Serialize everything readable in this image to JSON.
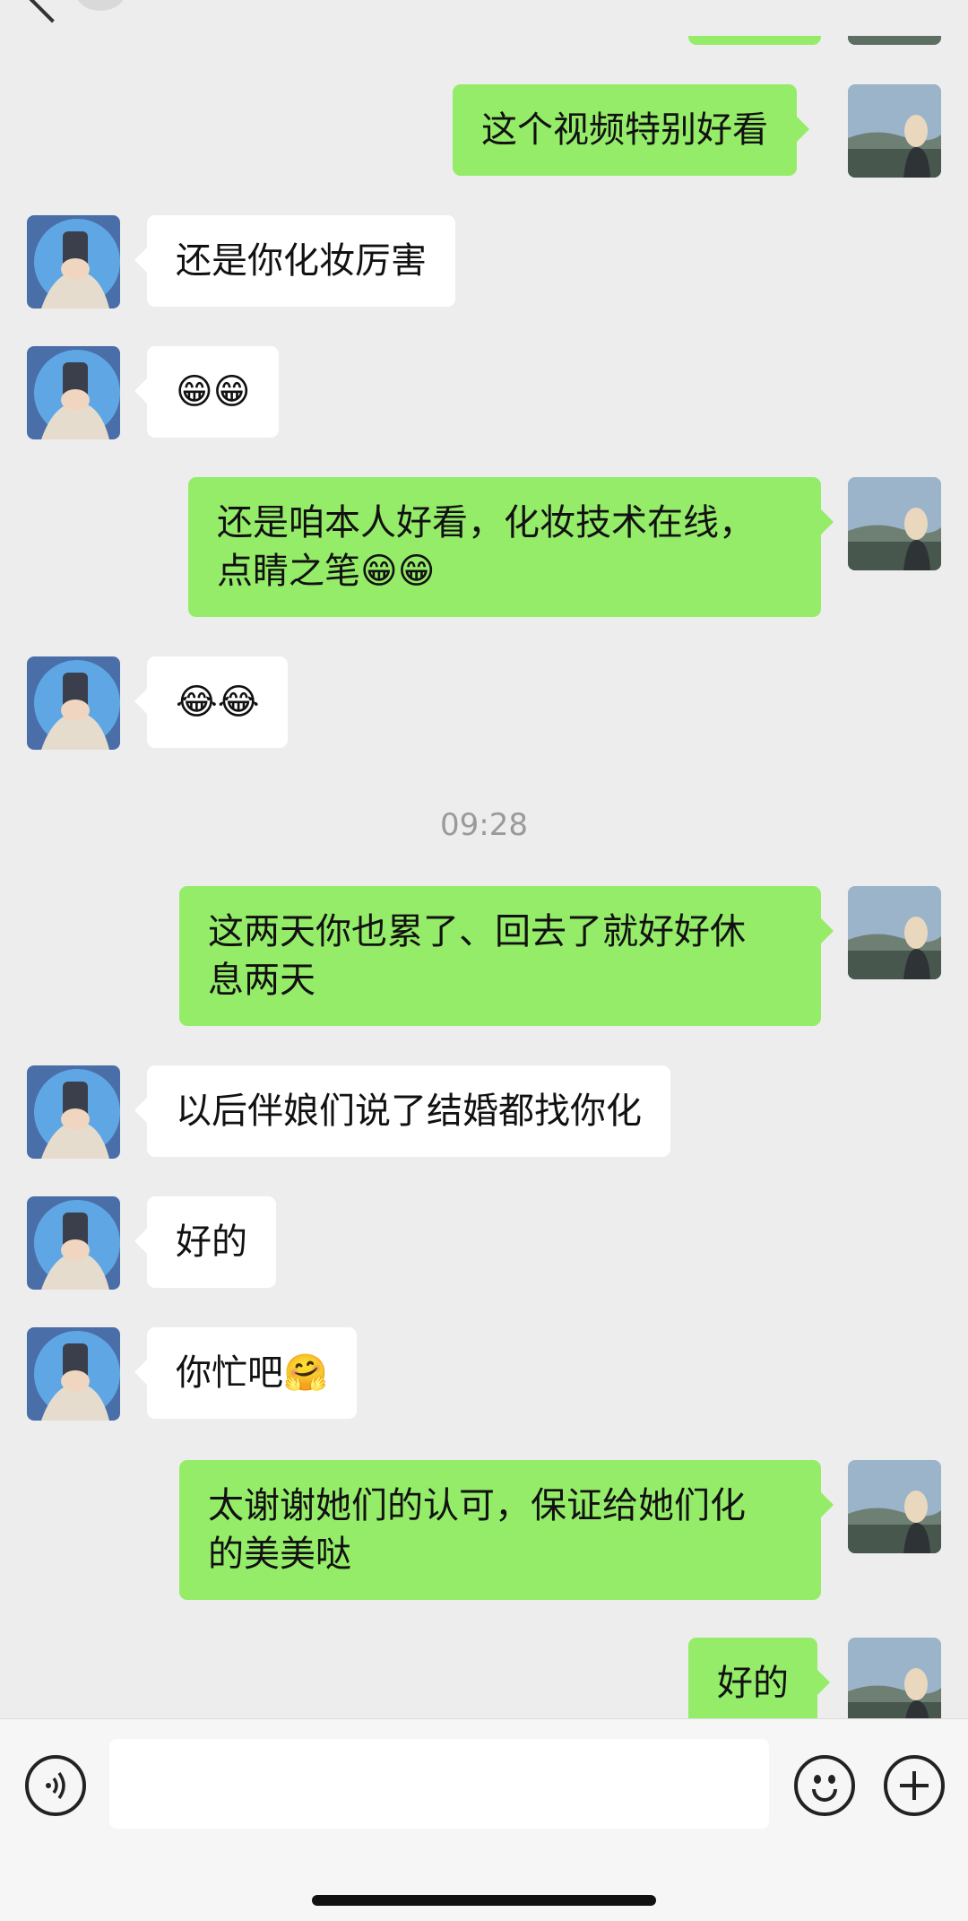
{
  "header": {
    "title": ""
  },
  "timestamp": "09:28",
  "messages": {
    "m1": "这个视频特别好看",
    "m2": "还是你化妆厉害",
    "m3": "😁😁",
    "m4": "还是咱本人好看，化妆技术在线，\n点睛之笔😁😁",
    "m5": "😂😂",
    "m6": "这两天你也累了、回去了就好好休\n息两天",
    "m7": "以后伴娘们说了结婚都找你化",
    "m8": "好的",
    "m9": "你忙吧🤗",
    "m10": "太谢谢她们的认可，保证给她们化\n的美美哒",
    "m11": "好的"
  },
  "input": {
    "placeholder": ""
  },
  "colors": {
    "background": "#ededed",
    "outgoing_bubble": "#95ec69",
    "incoming_bubble": "#ffffff",
    "timestamp_text": "#9a9a9a"
  },
  "icons": {
    "voice": "voice-icon",
    "emoji": "emoji-icon",
    "plus": "plus-icon"
  }
}
